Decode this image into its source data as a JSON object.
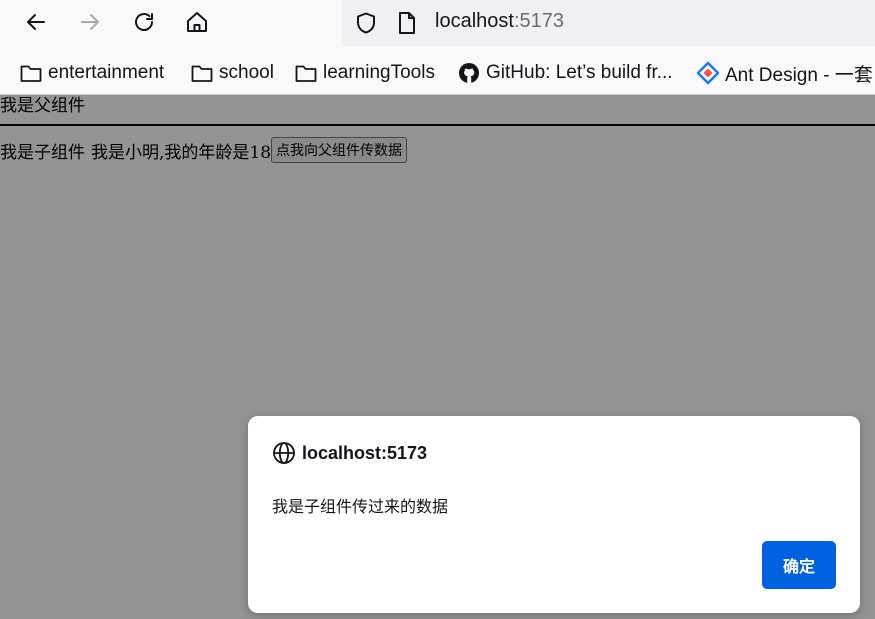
{
  "browser": {
    "url_host": "localhost",
    "url_port": ":5173",
    "icons": {
      "back": "back-arrow-icon",
      "forward": "forward-arrow-icon",
      "reload": "reload-icon",
      "home": "home-icon",
      "shield": "shield-icon",
      "page": "page-icon"
    },
    "bookmarks": [
      {
        "label": "entertainment",
        "icon": "folder-icon"
      },
      {
        "label": "school",
        "icon": "folder-icon"
      },
      {
        "label": "learningTools",
        "icon": "folder-icon"
      },
      {
        "label": "GitHub: Let’s build fr...",
        "icon": "github-icon"
      },
      {
        "label": "Ant Design - 一套",
        "icon": "ant-design-icon"
      }
    ]
  },
  "page": {
    "parent_heading": "我是父组件",
    "child_text": "我是子组件",
    "child_info": "我是小明,我的年龄是18",
    "send_button": "点我向父组件传数据"
  },
  "dialog": {
    "origin": "localhost:5173",
    "message": "我是子组件传过来的数据",
    "ok_button": "确定",
    "accent_color": "#0061e0"
  },
  "colors": {
    "overlay": "rgba(0,0,0,0.42)",
    "toolbar": "#f9f9fb",
    "urlbar": "#f0f0f4"
  }
}
